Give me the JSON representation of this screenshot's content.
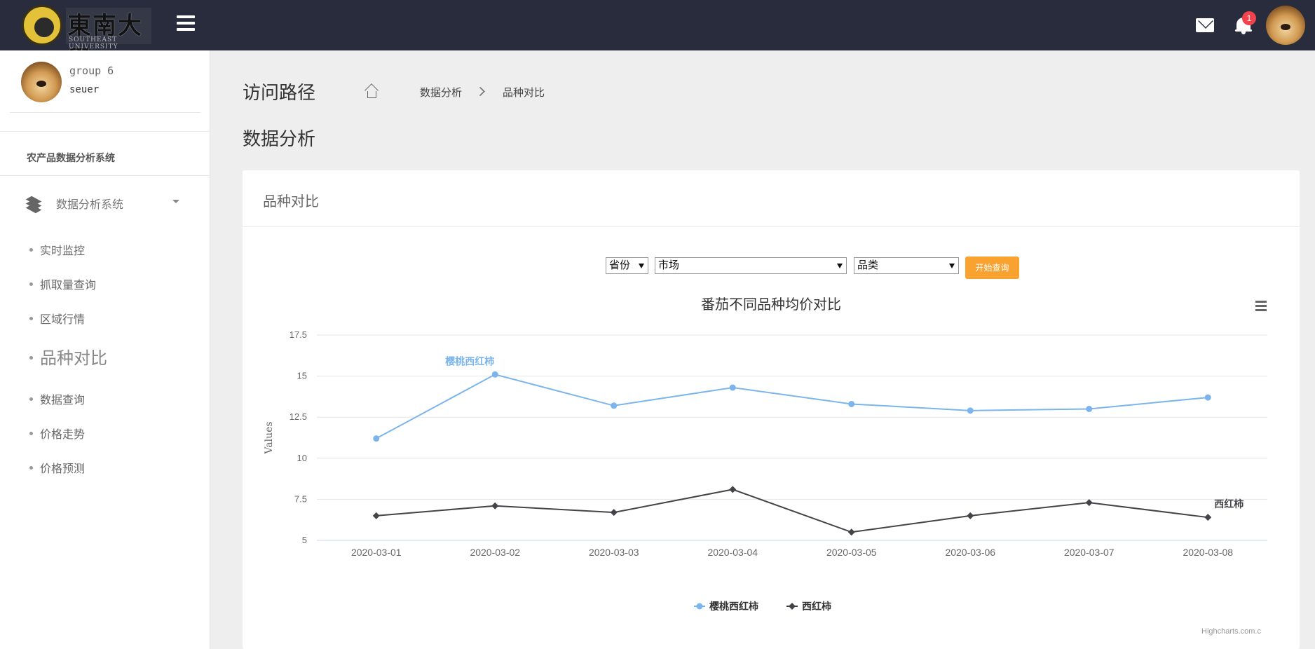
{
  "header": {
    "logo_text": "東南大學",
    "logo_subtext": "SOUTHEAST UNIVERSITY",
    "notification_count": "1"
  },
  "user": {
    "name": "group 6",
    "id": "seuer"
  },
  "sidebar": {
    "system_title": "农产品数据分析系统",
    "main_item": "数据分析系统",
    "items": [
      {
        "label": "实时监控",
        "active": false
      },
      {
        "label": "抓取量查询",
        "active": false
      },
      {
        "label": "区域行情",
        "active": false
      },
      {
        "label": "品种对比",
        "active": true
      },
      {
        "label": "数据查询",
        "active": false
      },
      {
        "label": "价格走势",
        "active": false
      },
      {
        "label": "价格预测",
        "active": false
      }
    ]
  },
  "breadcrumb": {
    "title": "访问路径",
    "items": [
      "数据分析",
      "品种对比"
    ]
  },
  "page_title": "数据分析",
  "panel": {
    "title": "品种对比",
    "filters": {
      "province": "省份",
      "market": "市场",
      "category": "品类",
      "query_button": "开始查询"
    }
  },
  "chart_credits": "Highcharts.com.c",
  "chart_data": {
    "type": "line",
    "title": "番茄不同品种均价对比",
    "ylabel": "Values",
    "xlabel": "",
    "ylim": [
      5,
      17.5
    ],
    "yticks": [
      "5",
      "7.5",
      "10",
      "12.5",
      "15",
      "17.5"
    ],
    "categories": [
      "2020-03-01",
      "2020-03-02",
      "2020-03-03",
      "2020-03-04",
      "2020-03-05",
      "2020-03-06",
      "2020-03-07",
      "2020-03-08"
    ],
    "legend_position": "bottom-center",
    "series": [
      {
        "name": "樱桃西红柿",
        "color": "#7cb5ec",
        "marker": "circle",
        "values": [
          11.2,
          15.1,
          13.2,
          14.3,
          13.3,
          12.9,
          13.0,
          13.7
        ]
      },
      {
        "name": "西红柿",
        "color": "#434348",
        "marker": "diamond",
        "values": [
          6.5,
          7.1,
          6.7,
          8.1,
          5.5,
          6.5,
          7.3,
          6.4
        ]
      }
    ]
  }
}
